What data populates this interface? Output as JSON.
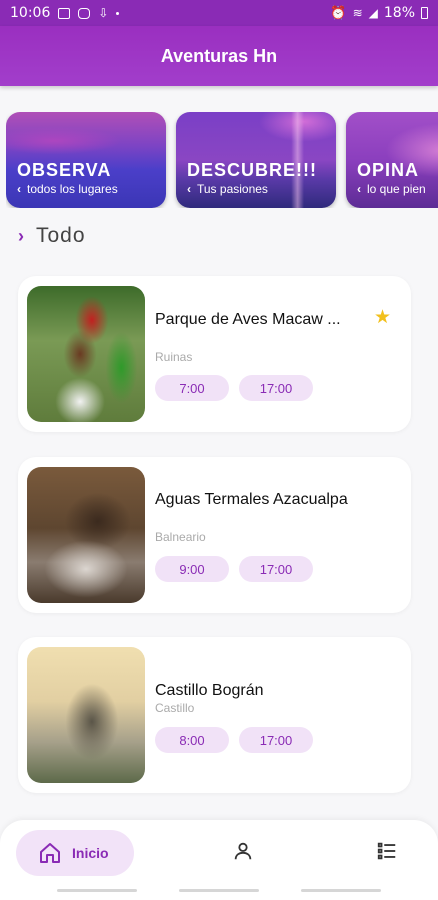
{
  "status_bar": {
    "time": "10:06",
    "battery": "18%"
  },
  "app": {
    "title": "Aventuras Hn"
  },
  "categories": [
    {
      "title": "OBSERVA",
      "subtitle": "todos los lugares"
    },
    {
      "title": "DESCUBRE!!!",
      "subtitle": "Tus pasiones"
    },
    {
      "title": "OPINA",
      "subtitle": "lo que pien"
    }
  ],
  "section": {
    "title": "Todo"
  },
  "places": [
    {
      "name": "Parque de Aves Macaw ...",
      "category": "Ruinas",
      "open": "7:00",
      "close": "17:00",
      "favorite": true
    },
    {
      "name": "Aguas Termales Azacualpa",
      "category": "Balneario",
      "open": "9:00",
      "close": "17:00",
      "favorite": false
    },
    {
      "name": "Castillo Bográn",
      "category": "Castillo",
      "open": "8:00",
      "close": "17:00",
      "favorite": false
    }
  ],
  "nav": {
    "home_label": "Inicio"
  },
  "colors": {
    "primary": "#8a2bb5",
    "chip_bg": "#f1e2f7",
    "star": "#f2c01d"
  }
}
